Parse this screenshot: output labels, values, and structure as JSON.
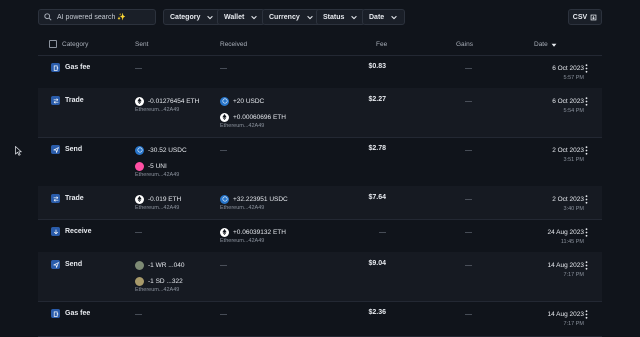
{
  "toolbar": {
    "search_placeholder": "AI powered search ✨",
    "filters": [
      "Category",
      "Wallet",
      "Currency",
      "Status",
      "Date"
    ],
    "csv_label": "CSV"
  },
  "columns": {
    "category": "Category",
    "sent": "Sent",
    "received": "Received",
    "fee": "Fee",
    "gains": "Gains",
    "date": "Date"
  },
  "rows": [
    {
      "category": "Gas fee",
      "icon": "gas-icon",
      "sent": "—",
      "sent_assets": [],
      "sent_addr": "",
      "received": "—",
      "received_assets": [],
      "received_addr": "",
      "fee": "$0.83",
      "gains": "—",
      "date": "6 Oct 2023",
      "time": "5:57 PM"
    },
    {
      "category": "Trade",
      "icon": "trade-icon",
      "sent": "",
      "sent_assets": [
        {
          "coin": "eth",
          "amount": "-0.01276454 ETH"
        }
      ],
      "sent_addr": "Ethereum...42A49",
      "received": "",
      "received_assets": [
        {
          "coin": "usdc",
          "amount": "+20 USDC"
        },
        {
          "coin": "eth",
          "amount": "+0.00060696 ETH"
        }
      ],
      "received_addr": "Ethereum...42A49",
      "fee": "$2.27",
      "gains": "—",
      "date": "6 Oct 2023",
      "time": "5:54 PM"
    },
    {
      "category": "Send",
      "icon": "send-icon",
      "sent": "",
      "sent_assets": [
        {
          "coin": "usdc",
          "amount": "-30.52 USDC"
        },
        {
          "coin": "uni",
          "amount": "-5 UNI"
        }
      ],
      "sent_addr": "Ethereum...42A49",
      "received": "—",
      "received_assets": [],
      "received_addr": "",
      "fee": "$2.78",
      "gains": "—",
      "date": "2 Oct 2023",
      "time": "3:51 PM"
    },
    {
      "category": "Trade",
      "icon": "trade-icon",
      "sent": "",
      "sent_assets": [
        {
          "coin": "eth",
          "amount": "-0.019 ETH"
        }
      ],
      "sent_addr": "Ethereum...42A49",
      "received": "",
      "received_assets": [
        {
          "coin": "usdc",
          "amount": "+32.223951 USDC"
        }
      ],
      "received_addr": "Ethereum...42A49",
      "fee": "$7.64",
      "gains": "—",
      "date": "2 Oct 2023",
      "time": "3:40 PM"
    },
    {
      "category": "Receive",
      "icon": "receive-icon",
      "sent": "—",
      "sent_assets": [],
      "sent_addr": "",
      "received": "",
      "received_assets": [
        {
          "coin": "eth",
          "amount": "+0.06039132 ETH"
        }
      ],
      "received_addr": "Ethereum...42A49",
      "fee": "—",
      "gains": "—",
      "date": "24 Aug 2023",
      "time": "11:45 PM"
    },
    {
      "category": "Send",
      "icon": "send-icon",
      "sent": "",
      "sent_assets": [
        {
          "coin": "nft",
          "amount": "-1 WR ...040"
        },
        {
          "coin": "nft2",
          "amount": "-1 SD ...322"
        }
      ],
      "sent_addr": "Ethereum...42A49",
      "received": "—",
      "received_assets": [],
      "received_addr": "",
      "fee": "$9.04",
      "gains": "—",
      "date": "14 Aug 2023",
      "time": "7:17 PM"
    },
    {
      "category": "Gas fee",
      "icon": "gas-icon",
      "sent": "—",
      "sent_assets": [],
      "sent_addr": "",
      "received": "—",
      "received_assets": [],
      "received_addr": "",
      "fee": "$2.36",
      "gains": "—",
      "date": "14 Aug 2023",
      "time": "7:17 PM"
    }
  ],
  "colors": {
    "background": "#10141b",
    "row_alt": "#161a22",
    "accent": "#2a5caa",
    "usdc": "#2775ca",
    "uni": "#ff4fa3"
  }
}
